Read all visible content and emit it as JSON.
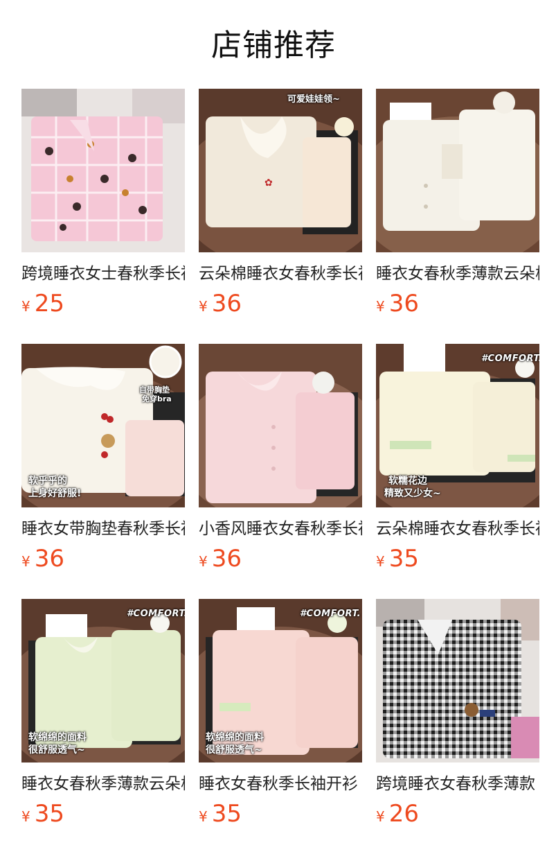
{
  "header": {
    "title": "店铺推荐"
  },
  "colors": {
    "price": "#ee4a1f",
    "title": "#222222"
  },
  "products": [
    {
      "title": "跨境睡衣女士春秋季长袖",
      "currency": "¥",
      "price": "25",
      "overlay": [],
      "image": "pink-plaid-pajama-set"
    },
    {
      "title": "云朵棉睡衣女春秋季长袖",
      "currency": "¥",
      "price": "36",
      "overlay": [
        "可爱娃娃领~"
      ],
      "image": "cream-doll-collar-set"
    },
    {
      "title": "睡衣女春秋季薄款云朵棉",
      "currency": "¥",
      "price": "36",
      "overlay": [],
      "image": "white-lace-set"
    },
    {
      "title": "睡衣女带胸垫春秋季长袖",
      "currency": "¥",
      "price": "36",
      "overlay": [
        "自带胸垫",
        "免穿bra",
        "软乎乎的",
        "上身好舒服!"
      ],
      "image": "white-cherry-bear-set"
    },
    {
      "title": "小香风睡衣女春秋季长袖",
      "currency": "¥",
      "price": "36",
      "overlay": [],
      "image": "pink-lace-set"
    },
    {
      "title": "云朵棉睡衣女春秋季长袖",
      "currency": "¥",
      "price": "35",
      "overlay": [
        "#COMFORT.",
        "软糯花边",
        "精致又少女~"
      ],
      "image": "cream-green-trim-set"
    },
    {
      "title": "睡衣女春秋季薄款云朵棉",
      "currency": "¥",
      "price": "35",
      "overlay": [
        "#COMFORT.",
        "软绵绵的面料",
        "很舒服透气~"
      ],
      "image": "mint-green-set"
    },
    {
      "title": "睡衣女春秋季长袖开衫",
      "currency": "¥",
      "price": "35",
      "overlay": [
        "#COMFORT.",
        "软绵绵的面料",
        "很舒服透气~"
      ],
      "image": "pink-cardigan-set"
    },
    {
      "title": "跨境睡衣女春秋季薄款",
      "currency": "¥",
      "price": "26",
      "overlay": [],
      "image": "black-gingham-set"
    }
  ]
}
